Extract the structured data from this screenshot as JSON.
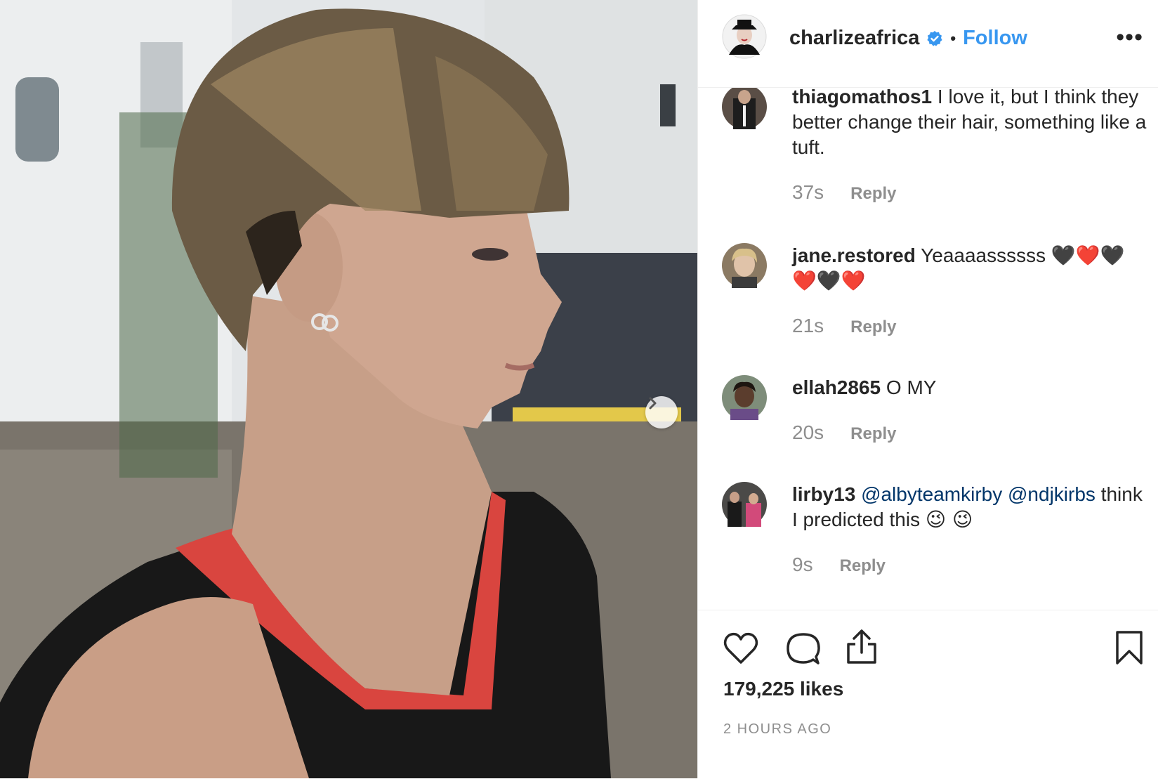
{
  "post": {
    "owner": "charlizeafrica",
    "separator": "•",
    "follow_label": "Follow",
    "more_label": "•••"
  },
  "comments": [
    {
      "user": "thiagomathos1",
      "text": "I love it, but I think they better change their hair, something like a tuft.",
      "time": "37s",
      "reply": "Reply"
    },
    {
      "user": "jane.restored",
      "text": "Yeaaaassssss",
      "emoji": "🖤❤️🖤 ❤️🖤❤️",
      "time": "21s",
      "reply": "Reply"
    },
    {
      "user": "ellah2865",
      "text": "O MY",
      "time": "20s",
      "reply": "Reply"
    },
    {
      "user": "lirby13",
      "mention1": "@albyteamkirby",
      "mention2": "@ndjkirbs",
      "text": "think I predicted this",
      "emoji": "😉 😉",
      "time": "9s",
      "reply": "Reply"
    }
  ],
  "stats": {
    "likes": "179,225 likes",
    "posted": "2 HOURS AGO"
  },
  "icons": [
    "verified-badge-icon",
    "heart-icon",
    "comment-icon",
    "share-icon",
    "bookmark-icon",
    "chevron-right-icon"
  ],
  "colors": {
    "link": "#3897f0",
    "mention": "#003569",
    "meta": "#8e8e8e",
    "text": "#262626"
  }
}
